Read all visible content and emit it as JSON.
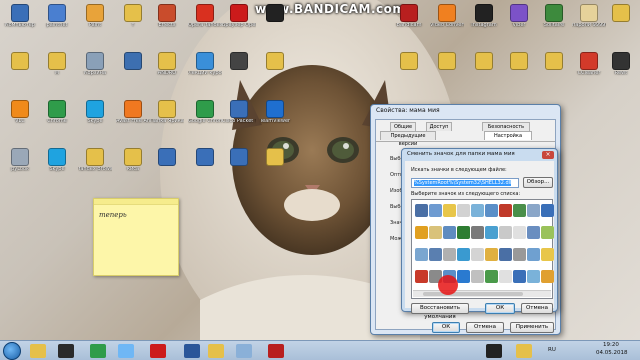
{
  "watermark": "www.BANDICAM.com",
  "desktop_icons": [
    {
      "label": "Компьютер",
      "color": "#3a6fb8"
    },
    {
      "label": "paintnet",
      "color": "#4a7fd0"
    },
    {
      "label": "Paint",
      "color": "#e8a33a"
    },
    {
      "label": "т",
      "color": "#e5c04a"
    },
    {
      "label": "Effects",
      "color": "#c94c2c"
    },
    {
      "label": "Opera Yandex",
      "color": "#d9301f"
    },
    {
      "label": "Браузер Opera",
      "color": "#cc1b1b"
    },
    {
      "label": "",
      "color": "#222222"
    },
    {
      "label": "Bandicam",
      "color": "#b81f1f"
    },
    {
      "label": "Video Converter",
      "color": "#f08020"
    },
    {
      "label": "Instagram",
      "color": "#222222"
    },
    {
      "label": "Viber",
      "color": "#7c52c8"
    },
    {
      "label": "Solitaire",
      "color": "#3d8a3d"
    },
    {
      "label": "пароли 99999",
      "color": "#e6d29a"
    },
    {
      "label": "",
      "color": "#e5c04a"
    },
    {
      "label": "",
      "color": "#e5c04a"
    },
    {
      "label": "м",
      "color": "#e5c04a"
    },
    {
      "label": "Корзина",
      "color": "#8aa0b8"
    },
    {
      "label": "",
      "color": "#3d6fb0"
    },
    {
      "label": "ANDRO",
      "color": "#e5c04a"
    },
    {
      "label": "Лекции курсорной",
      "color": "#3a8fd9"
    },
    {
      "label": "",
      "color": "#444444"
    },
    {
      "label": "",
      "color": "#e5c04a"
    },
    {
      "label": "",
      "color": "#e5c04a"
    },
    {
      "label": "",
      "color": "#e5c04a"
    },
    {
      "label": "",
      "color": "#e5c04a"
    },
    {
      "label": "",
      "color": "#e5c04a"
    },
    {
      "label": "",
      "color": "#e5c04a"
    },
    {
      "label": "CCleaner",
      "color": "#d23a2a"
    },
    {
      "label": "Rewt",
      "color": "#333333"
    },
    {
      "label": "VLC",
      "color": "#f08a1a"
    },
    {
      "label": "Chrome",
      "color": "#2f9c4a"
    },
    {
      "label": "Skype",
      "color": "#1fa3e0"
    },
    {
      "label": "Avast Free Antivirus",
      "color": "#f07820"
    },
    {
      "label": "Папка Ярика",
      "color": "#e5c04a"
    },
    {
      "label": "Google Chrome",
      "color": "#2f9c4a"
    },
    {
      "label": "Cisco Packet Tracer",
      "color": "#3a6fb8"
    },
    {
      "label": "TeamViewer",
      "color": "#1f6fd0"
    },
    {
      "label": "pyLook",
      "color": "#9aa8b8"
    },
    {
      "label": "Skype",
      "color": "#1fa3e0"
    },
    {
      "label": "Yandex Browser",
      "color": "#e5c04a"
    },
    {
      "label": "киса",
      "color": "#e5c04a"
    },
    {
      "label": "",
      "color": "#3a6fb8"
    },
    {
      "label": "",
      "color": "#3a6fb8"
    },
    {
      "label": "",
      "color": "#3a6fb8"
    },
    {
      "label": "",
      "color": "#e5c04a"
    },
    {
      "label": "",
      "color": "#e5c04a"
    },
    {
      "label": "Portable Files",
      "color": "#e5c04a"
    }
  ],
  "sticky_note": {
    "text": "теперь"
  },
  "properties_window": {
    "title": "Свойства: мама мия",
    "tabs": [
      "Общие",
      "Доступ",
      "Безопасность",
      "Предыдущие версии",
      "Настройка"
    ],
    "side_labels": [
      "Выбо",
      "Оптим",
      "Изоб",
      "Выбо",
      "Значе",
      "Можн"
    ],
    "buttons": {
      "ok": "ОК",
      "cancel": "Отмена",
      "apply": "Применить"
    }
  },
  "change_icon_dialog": {
    "title": "Сменить значок для папки мама мия",
    "search_label": "Искать значки в следующем файле:",
    "file_path": "%SystemRoot%\\System32\\SHELL32.dll",
    "browse_button": "Обзор...",
    "select_label": "Выберите значок из следующего списка:",
    "restore_button": "Восстановить умолчания",
    "ok_button": "ОК",
    "cancel_button": "Отмена",
    "icon_colors": [
      "#4a6fa5",
      "#6e9bd1",
      "#e8c64a",
      "#d2d2d2",
      "#7ab2d9",
      "#5a8fc8",
      "#c03a2a",
      "#4a8f4a",
      "#8aa6c8",
      "#3a6fb8",
      "#e1a020",
      "#d9c27a",
      "#5f8cc0",
      "#2e7d32",
      "#7a7a7a",
      "#4aa0d0",
      "#c9c9c9",
      "#e0e0e0",
      "#6a8ec0",
      "#9ac25a",
      "#7aa6d0",
      "#5a7fb0",
      "#b0b0b0",
      "#3a9ad0",
      "#d4d4d4",
      "#e0b040",
      "#4a6fa5",
      "#999999",
      "#6fa0d0",
      "#e8c64a",
      "#c83a2a",
      "#8a8a8a",
      "#5a8fc8",
      "#2a7ad0",
      "#c0c0c0",
      "#4a9a4a",
      "#e0e0e0",
      "#3a6fb8",
      "#7ab2d9",
      "#e0a030"
    ]
  },
  "taskbar": {
    "apps": [
      {
        "name": "explorer",
        "color": "#e5c04a"
      },
      {
        "name": "media",
        "color": "#2a2a2a"
      },
      {
        "name": "chrome",
        "color": "#2f9c4a"
      },
      {
        "name": "windows",
        "color": "#6fb7f5"
      },
      {
        "name": "opera",
        "color": "#cc1b1b"
      },
      {
        "name": "word",
        "color": "#2a5699"
      },
      {
        "name": "yandex",
        "color": "#e5c04a"
      },
      {
        "name": "control",
        "color": "#8ab0d8"
      },
      {
        "name": "bandicam",
        "color": "#b81f1f"
      },
      {
        "name": "cmd",
        "color": "#222222"
      },
      {
        "name": "folder",
        "color": "#e5c04a"
      }
    ],
    "tray_lang": "RU",
    "time": "19:20",
    "date": "04.05.2018"
  }
}
